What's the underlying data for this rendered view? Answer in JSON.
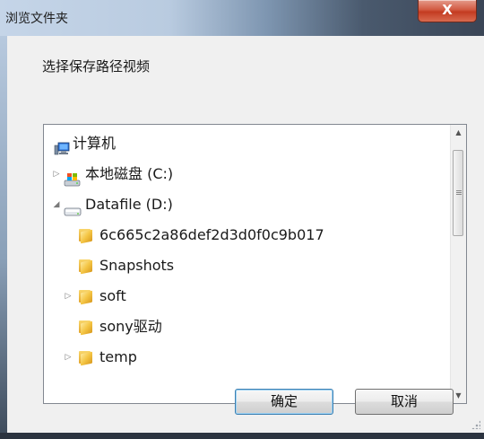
{
  "window": {
    "title": "浏览文件夹",
    "close_label": "X"
  },
  "description": "选择保存路径视频",
  "tree": {
    "items": [
      {
        "label": "计算机",
        "icon": "computer-icon",
        "expander": ""
      },
      {
        "label": "本地磁盘 (C:)",
        "icon": "local-disk-icon",
        "expander": "▷"
      },
      {
        "label": "Datafile (D:)",
        "icon": "drive-icon",
        "expander": "◢"
      },
      {
        "label": "6c665c2a86def2d3d0f0c9b017",
        "icon": "folder-icon",
        "expander": ""
      },
      {
        "label": "Snapshots",
        "icon": "folder-icon",
        "expander": ""
      },
      {
        "label": "soft",
        "icon": "folder-icon",
        "expander": "▷"
      },
      {
        "label": "sony驱动",
        "icon": "folder-icon",
        "expander": ""
      },
      {
        "label": "temp",
        "icon": "folder-icon",
        "expander": "▷"
      }
    ]
  },
  "buttons": {
    "ok": "确定",
    "cancel": "取消"
  },
  "scrollbar": {
    "up_arrow": "▲",
    "down_arrow": "▼"
  }
}
